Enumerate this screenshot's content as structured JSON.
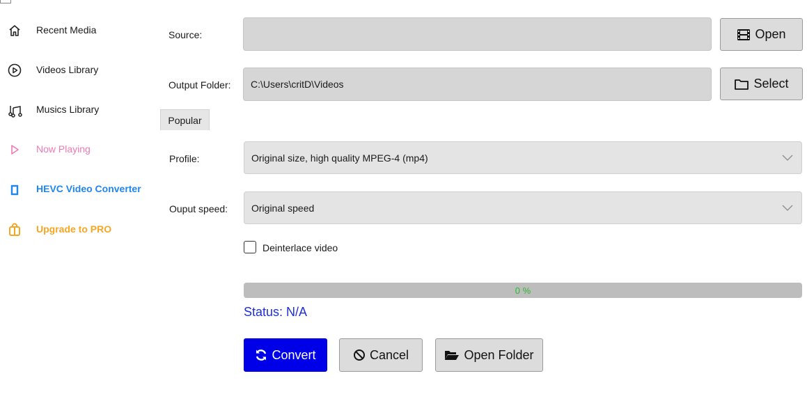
{
  "sidebar": {
    "cut_label": "Library",
    "items": [
      {
        "label": "Recent Media",
        "icon": "home-icon",
        "color": "#1a1a1a"
      },
      {
        "label": "Videos Library",
        "icon": "play-circle-icon",
        "color": "#1a1a1a"
      },
      {
        "label": "Musics Library",
        "icon": "music-note-icon",
        "color": "#1a1a1a"
      },
      {
        "label": "Now Playing",
        "icon": "play-triangle-icon",
        "color": "#f07ab3"
      },
      {
        "label": "HEVC Video Converter",
        "icon": "converter-icon",
        "color": "#1f86ee"
      },
      {
        "label": "Upgrade to PRO",
        "icon": "gift-bag-icon",
        "color": "#f5a623"
      }
    ]
  },
  "form": {
    "source_label": "Source:",
    "source_value": "",
    "open_button": "Open",
    "output_label": "Output Folder:",
    "output_value": "C:\\Users\\critD\\Videos",
    "select_button": "Select",
    "tab_popular": "Popular",
    "profile_label": "Profile:",
    "profile_value": "Original size, high quality MPEG-4 (mp4)",
    "speed_label": "Ouput speed:",
    "speed_value": "Original speed",
    "deinterlace_label": "Deinterlace video",
    "deinterlace_checked": false
  },
  "progress": {
    "value": 0,
    "text": "0 %"
  },
  "status_text": "Status: N/A",
  "actions": {
    "convert": "Convert",
    "cancel": "Cancel",
    "open_folder": "Open Folder"
  },
  "colors": {
    "primary_button": "#0000e8",
    "status_text": "#1e2fd8",
    "progress_text": "#2eb82e"
  }
}
